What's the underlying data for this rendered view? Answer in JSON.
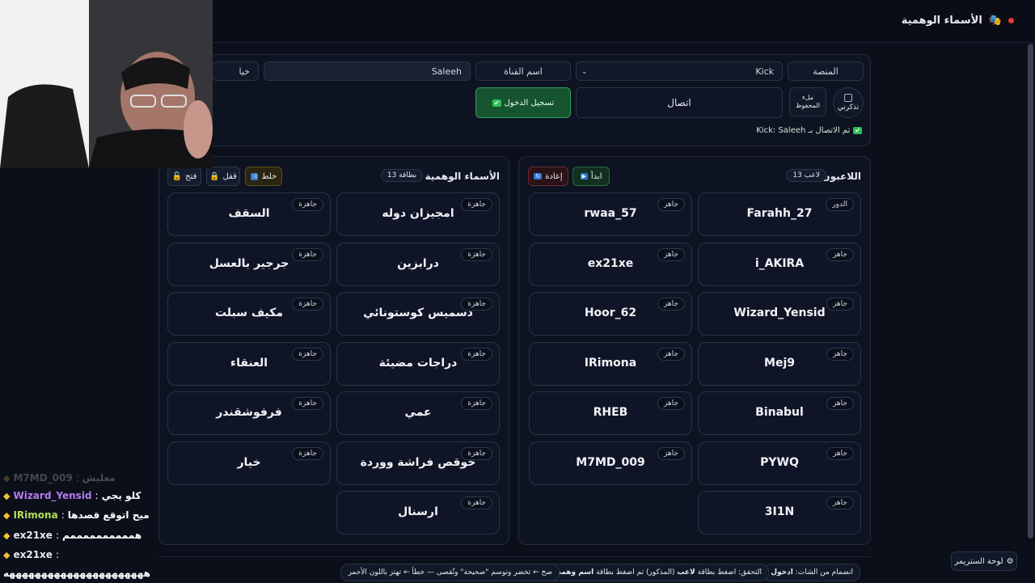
{
  "header": {
    "title": "الأسماء الوهمية",
    "icon": "masks-icon"
  },
  "connect": {
    "platform_label": "المنصة",
    "platform_value": "Kick",
    "channel_label": "اسم القناة",
    "channel_value": "Saleeh",
    "partial_field": "خيا",
    "remember_label": "تذكرني",
    "autosave_label": "ملء المحفوظ",
    "connect_button": "اتصال",
    "login_button": "تسجيل الدخول",
    "status": "تم الاتصال بـ Kick: Saleeh"
  },
  "players": {
    "title": "اللاعبون",
    "count": "13 لاعب",
    "start_button": "ابدأ",
    "reset_button": "إعادة",
    "items": [
      {
        "name": "Farahh_27",
        "status": "الدور"
      },
      {
        "name": "rwaa_57",
        "status": "جاهز"
      },
      {
        "name": "i_AKIRA",
        "status": "جاهز"
      },
      {
        "name": "ex21xe",
        "status": "جاهز"
      },
      {
        "name": "Wizard_Yensid",
        "status": "جاهز"
      },
      {
        "name": "Hoor_62",
        "status": "جاهز"
      },
      {
        "name": "Mej9",
        "status": "جاهز"
      },
      {
        "name": "IRimona",
        "status": "جاهز"
      },
      {
        "name": "Binabul",
        "status": "جاهز"
      },
      {
        "name": "RHEB",
        "status": "جاهز"
      },
      {
        "name": "PYWQ",
        "status": "جاهز"
      },
      {
        "name": "M7MD_009",
        "status": "جاهز"
      },
      {
        "name": "3I1N",
        "status": "جاهز"
      }
    ]
  },
  "names": {
    "title": "الأسماء الوهمية",
    "count": "13 بطاقة",
    "shuffle_button": "خلط",
    "lock_button": "قفل",
    "open_button": "فتح",
    "items": [
      {
        "name": "امجيزان دوله",
        "status": "جاهزة"
      },
      {
        "name": "السقف",
        "status": "جاهزة"
      },
      {
        "name": "درابزين",
        "status": "جاهزة"
      },
      {
        "name": "جرجير بالعسل",
        "status": "جاهزة"
      },
      {
        "name": "دسميس كوستونائي",
        "status": "جاهزة"
      },
      {
        "name": "مكيف سبلت",
        "status": "جاهزة"
      },
      {
        "name": "دراجات مضيئة",
        "status": "جاهزة"
      },
      {
        "name": "العنقاء",
        "status": "جاهزة"
      },
      {
        "name": "عمي",
        "status": "جاهزة"
      },
      {
        "name": "فرفوشقندر",
        "status": "جاهزة"
      },
      {
        "name": "خوقص فراشة ووردة",
        "status": "جاهزة"
      },
      {
        "name": "خيار",
        "status": "جاهزة"
      },
      {
        "name": "ارسنال",
        "status": "جاهزة"
      }
    ]
  },
  "footer": {
    "hint1_pre": "انضمام من الشات:",
    "hint1_bold": "ادخول",
    "hint2_pre": "التحقق: اضغط بطاقة",
    "hint2_bold1": "لاعب",
    "hint2_mid": "(المذكور) ثم اضغط بطاقة",
    "hint2_bold2": "اسم وهمي",
    "hint3": "صح ← تخضر وتوسم \"صحيحة\" وتُقصى — خطأ ← تهتز باللون الأحمر",
    "streamer_panel": "لوحة الستريمر"
  },
  "chat": [
    {
      "user": "M7MD_009",
      "message": "معليش",
      "faded": true
    },
    {
      "user": "Wizard_Yensid",
      "message": "كلو يجي",
      "color": "#b57cf0"
    },
    {
      "user": "IRimona",
      "message": "ميح اتوقع قصدها",
      "color": "#b3e05a"
    },
    {
      "user": "ex21xe",
      "message": "هممممممممممم",
      "color": "#e6e9f0"
    },
    {
      "user": "ex21xe",
      "message": "",
      "color": "#e6e9f0"
    },
    {
      "user": "",
      "message": "ههههههههههههههههههههههه",
      "color": "#e6e9f0"
    }
  ],
  "colors": {
    "accent_green": "#1a7f3c",
    "danger": "#c0392b",
    "bg": "#0b0f19"
  }
}
